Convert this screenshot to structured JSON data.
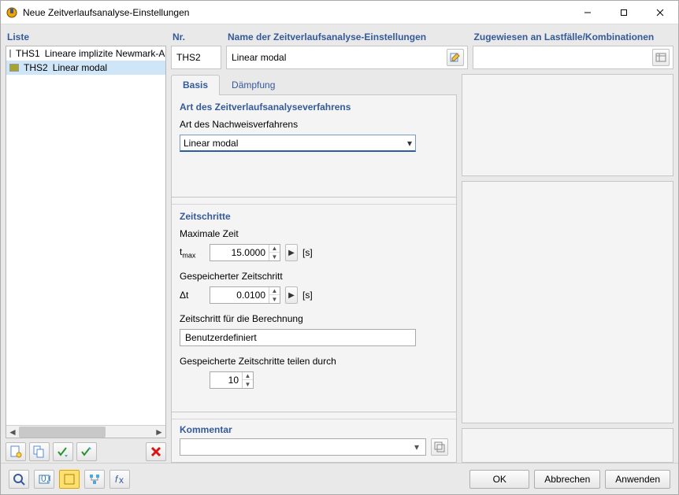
{
  "window": {
    "title": "Neue Zeitverlaufsanalyse-Einstellungen"
  },
  "left": {
    "heading": "Liste",
    "items": [
      {
        "code": "THS1",
        "desc": "Lineare implizite Newmark-A",
        "color": "#bff4ee",
        "selected": false
      },
      {
        "code": "THS2",
        "desc": "Linear modal",
        "color": "#a4a42f",
        "selected": true
      }
    ]
  },
  "top": {
    "nr_label": "Nr.",
    "nr_value": "THS2",
    "name_label": "Name der Zeitverlaufsanalyse-Einstellungen",
    "name_value": "Linear modal",
    "assigned_label": "Zugewiesen an Lastfälle/Kombinationen",
    "assigned_value": ""
  },
  "tabs": {
    "basis": "Basis",
    "damping": "Dämpfung"
  },
  "method": {
    "heading": "Art des Zeitverlaufsanalyseverfahrens",
    "label": "Art des Nachweisverfahrens",
    "value": "Linear modal"
  },
  "steps": {
    "heading": "Zeitschritte",
    "tmax_label": "Maximale Zeit",
    "tmax_sym": "t",
    "tmax_sub": "max",
    "tmax_value": "15.0000",
    "tmax_unit": "[s]",
    "dt_label": "Gespeicherter Zeitschritt",
    "dt_sym": "Δt",
    "dt_value": "0.0100",
    "dt_unit": "[s]",
    "calc_label": "Zeitschritt für die Berechnung",
    "calc_value": "Benutzerdefiniert",
    "div_label": "Gespeicherte Zeitschritte teilen durch",
    "div_value": "10"
  },
  "comment": {
    "heading": "Kommentar",
    "value": ""
  },
  "footer": {
    "ok": "OK",
    "cancel": "Abbrechen",
    "apply": "Anwenden"
  }
}
